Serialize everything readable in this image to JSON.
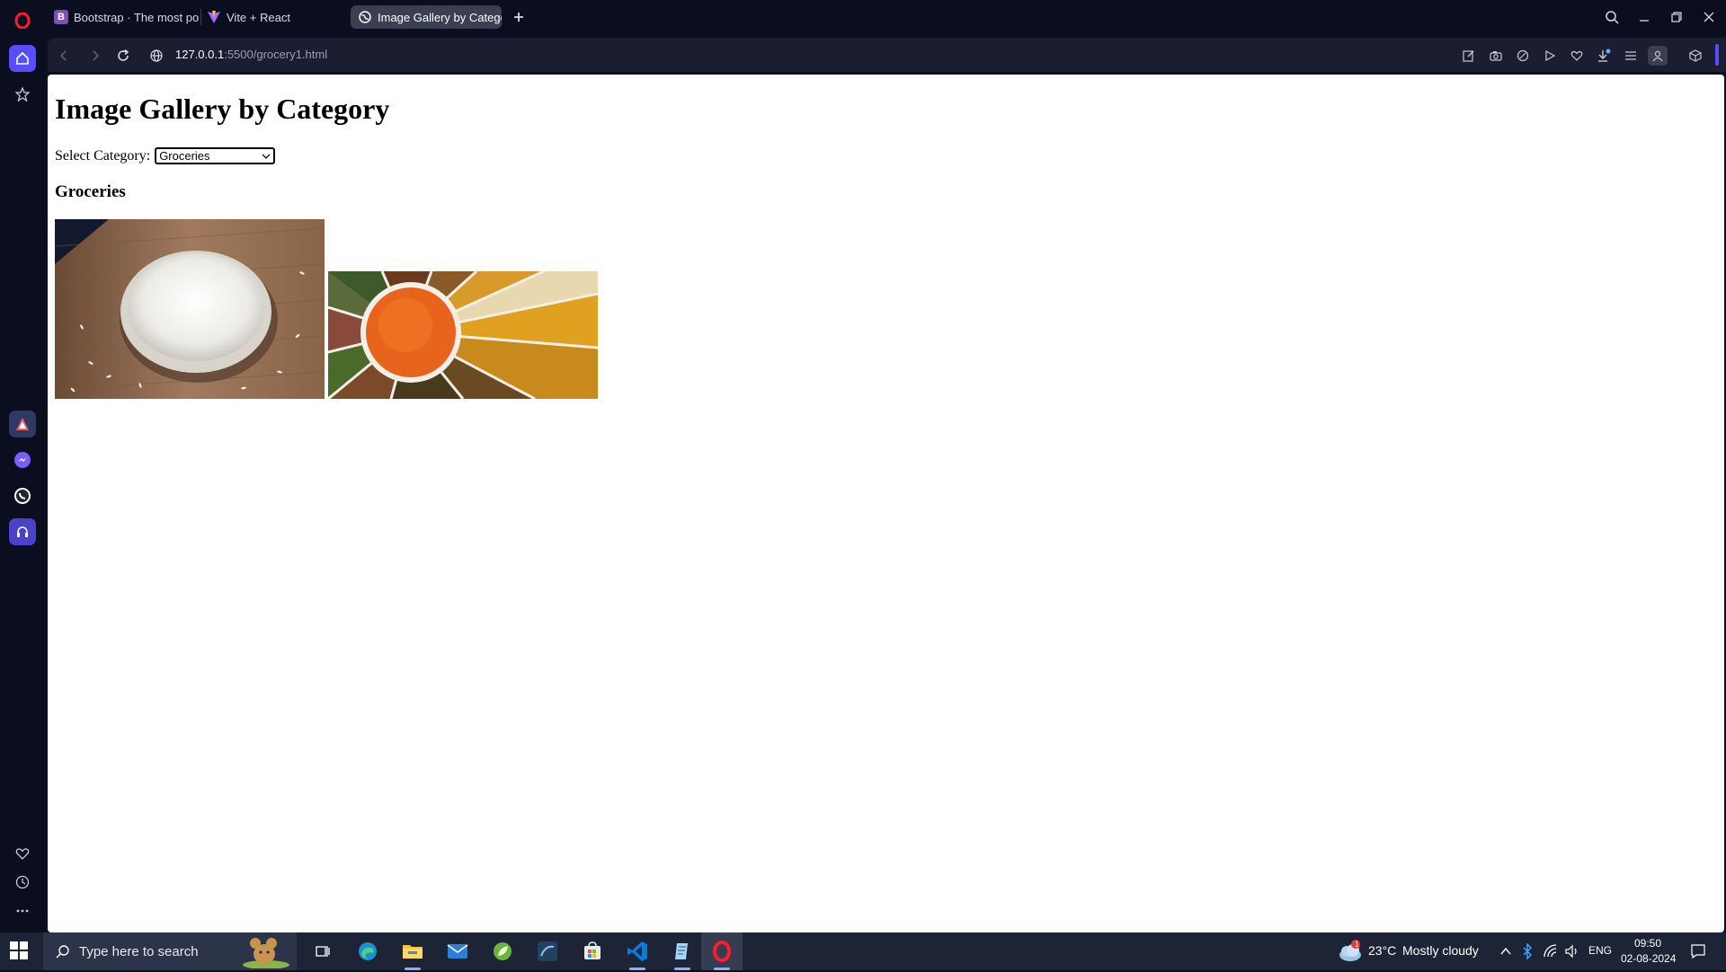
{
  "browser": {
    "tabs": [
      {
        "label": "Bootstrap · The most popu",
        "favicon": "bootstrap-icon",
        "favicon_color": "#7952b3",
        "active": false
      },
      {
        "label": "Vite + React",
        "favicon": "vite-icon",
        "favicon_color": "#bd34fe",
        "active": false
      },
      {
        "label": "Image Gallery by Categor",
        "favicon": "globe-icon",
        "favicon_color": "#ffffff",
        "active": true
      }
    ],
    "url_host": "127.0.0.1",
    "url_path": ":5500/grocery1.html",
    "accent_color": "#5a4cff"
  },
  "page": {
    "title": "Image Gallery by Category",
    "select_label": "Select Category:",
    "select_value": "Groceries",
    "category_heading": "Groceries",
    "images": [
      {
        "name": "rice-bowl-image",
        "description_icon": "rice-image"
      },
      {
        "name": "lentils-platter-image",
        "description_icon": "lentils-image"
      }
    ]
  },
  "taskbar": {
    "search_placeholder": "Type here to search",
    "weather_temp": "23°C",
    "weather_text": "Mostly cloudy",
    "weather_badge": "1",
    "language": "ENG",
    "time": "09:50",
    "date": "02-08-2024"
  }
}
